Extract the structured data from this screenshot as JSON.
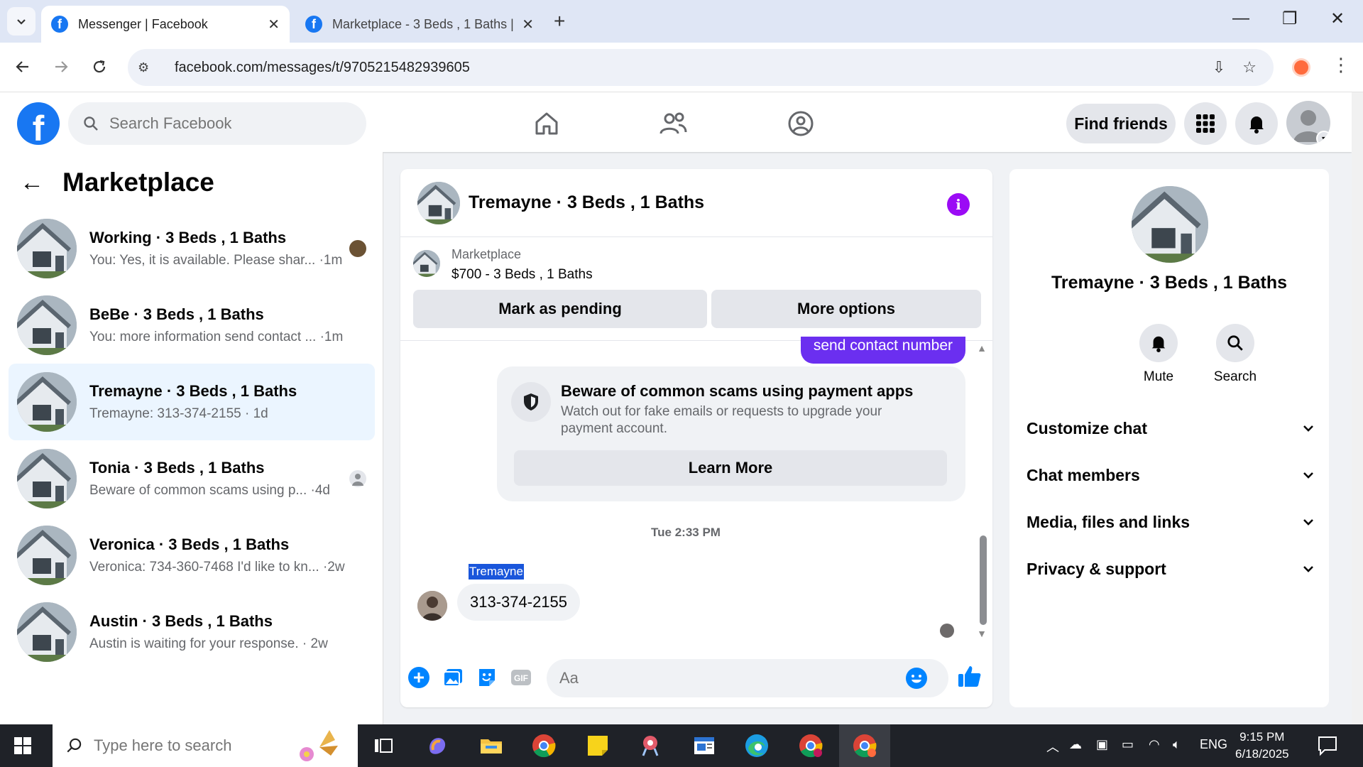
{
  "browser": {
    "tabs": [
      {
        "title": "Messenger | Facebook",
        "active": true
      },
      {
        "title": "Marketplace - 3 Beds , 1 Baths |",
        "active": false
      }
    ],
    "url": "facebook.com/messages/t/9705215482939605"
  },
  "fb": {
    "search_placeholder": "Search Facebook",
    "find_friends": "Find friends"
  },
  "left": {
    "title": "Marketplace",
    "conversations": [
      {
        "name": "Working · 3 Beds , 1 Baths",
        "snippet": "You: Yes, it is available. Please shar... ·1m",
        "selected": false
      },
      {
        "name": "BeBe · 3 Beds , 1 Baths",
        "snippet": "You: more information send contact ... ·1m",
        "selected": false
      },
      {
        "name": "Tremayne · 3 Beds , 1 Baths",
        "snippet": "Tremayne: 313-374-2155 · 1d",
        "selected": true
      },
      {
        "name": "Tonia · 3 Beds , 1 Baths",
        "snippet": "Beware of common scams using p... ·4d",
        "selected": false
      },
      {
        "name": "Veronica · 3 Beds , 1 Baths",
        "snippet": "Veronica: 734-360-7468 I'd like to kn... ·2w",
        "selected": false
      },
      {
        "name": "Austin · 3 Beds , 1 Baths",
        "snippet": "Austin is waiting for your response. · 2w",
        "selected": false
      }
    ]
  },
  "chat": {
    "title": "Tremayne · 3 Beds , 1 Baths",
    "listing": {
      "category": "Marketplace",
      "price_line": "$700 - 3 Beds , 1 Baths",
      "mark_pending": "Mark as pending",
      "more_options": "More options"
    },
    "sent_message": "send contact number",
    "scam": {
      "title": "Beware of common scams using payment apps",
      "body": "Watch out for fake emails or requests to upgrade your payment account.",
      "learn_more": "Learn More"
    },
    "timestamp": "Tue 2:33 PM",
    "sender": "Tremayne",
    "received_message": "313-374-2155",
    "composer_placeholder": "Aa"
  },
  "right": {
    "title": "Tremayne · 3 Beds , 1 Baths",
    "actions": {
      "mute": "Mute",
      "search": "Search"
    },
    "sections": [
      "Customize chat",
      "Chat members",
      "Media, files and links",
      "Privacy & support"
    ]
  },
  "taskbar": {
    "search_placeholder": "Type here to search",
    "lang": "ENG",
    "time": "9:15 PM",
    "date": "6/18/2025"
  },
  "colors": {
    "fb_blue": "#1877f2",
    "selected_bg": "#ebf5ff",
    "messenger_purple": "#6b2ff0"
  }
}
